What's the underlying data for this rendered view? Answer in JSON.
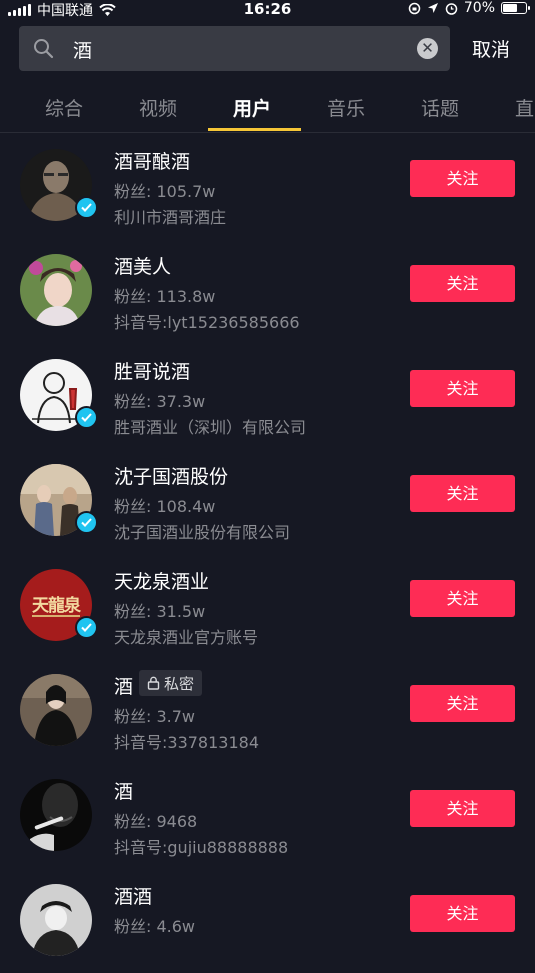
{
  "status_bar": {
    "carrier": "中国联通",
    "time": "16:26",
    "battery_text": "70%",
    "battery_level": 0.7
  },
  "search": {
    "query": "酒",
    "cancel_label": "取消"
  },
  "tabs": [
    {
      "label": "综合"
    },
    {
      "label": "视频"
    },
    {
      "label": "用户",
      "active": true
    },
    {
      "label": "音乐"
    },
    {
      "label": "话题"
    },
    {
      "label": "直"
    }
  ],
  "users": [
    {
      "name": "酒哥酿酒",
      "fans": "粉丝: 105.7w",
      "desc": "利川市酒哥酒庄",
      "verified": true,
      "follow_label": "关注"
    },
    {
      "name": "酒美人",
      "fans": "粉丝: 113.8w",
      "desc": "抖音号:lyt15236585666",
      "verified": false,
      "follow_label": "关注"
    },
    {
      "name": "胜哥说酒",
      "fans": "粉丝: 37.3w",
      "desc": "胜哥酒业（深圳）有限公司",
      "verified": true,
      "follow_label": "关注"
    },
    {
      "name": "沈子国酒股份",
      "fans": "粉丝: 108.4w",
      "desc": "沈子国酒业股份有限公司",
      "verified": true,
      "follow_label": "关注"
    },
    {
      "name": "天龙泉酒业",
      "fans": "粉丝: 31.5w",
      "desc": "天龙泉酒业官方账号",
      "verified": true,
      "follow_label": "关注",
      "avatar_text": "天龍泉"
    },
    {
      "name": "酒",
      "fans": "粉丝: 3.7w",
      "desc": "抖音号:337813184",
      "verified": false,
      "private_label": "私密",
      "follow_label": "关注"
    },
    {
      "name": "酒",
      "fans": "粉丝: 9468",
      "desc": "抖音号:gujiu88888888",
      "verified": false,
      "follow_label": "关注"
    },
    {
      "name": "酒酒",
      "fans": "粉丝: 4.6w",
      "desc": "",
      "verified": false,
      "follow_label": "关注"
    }
  ]
}
